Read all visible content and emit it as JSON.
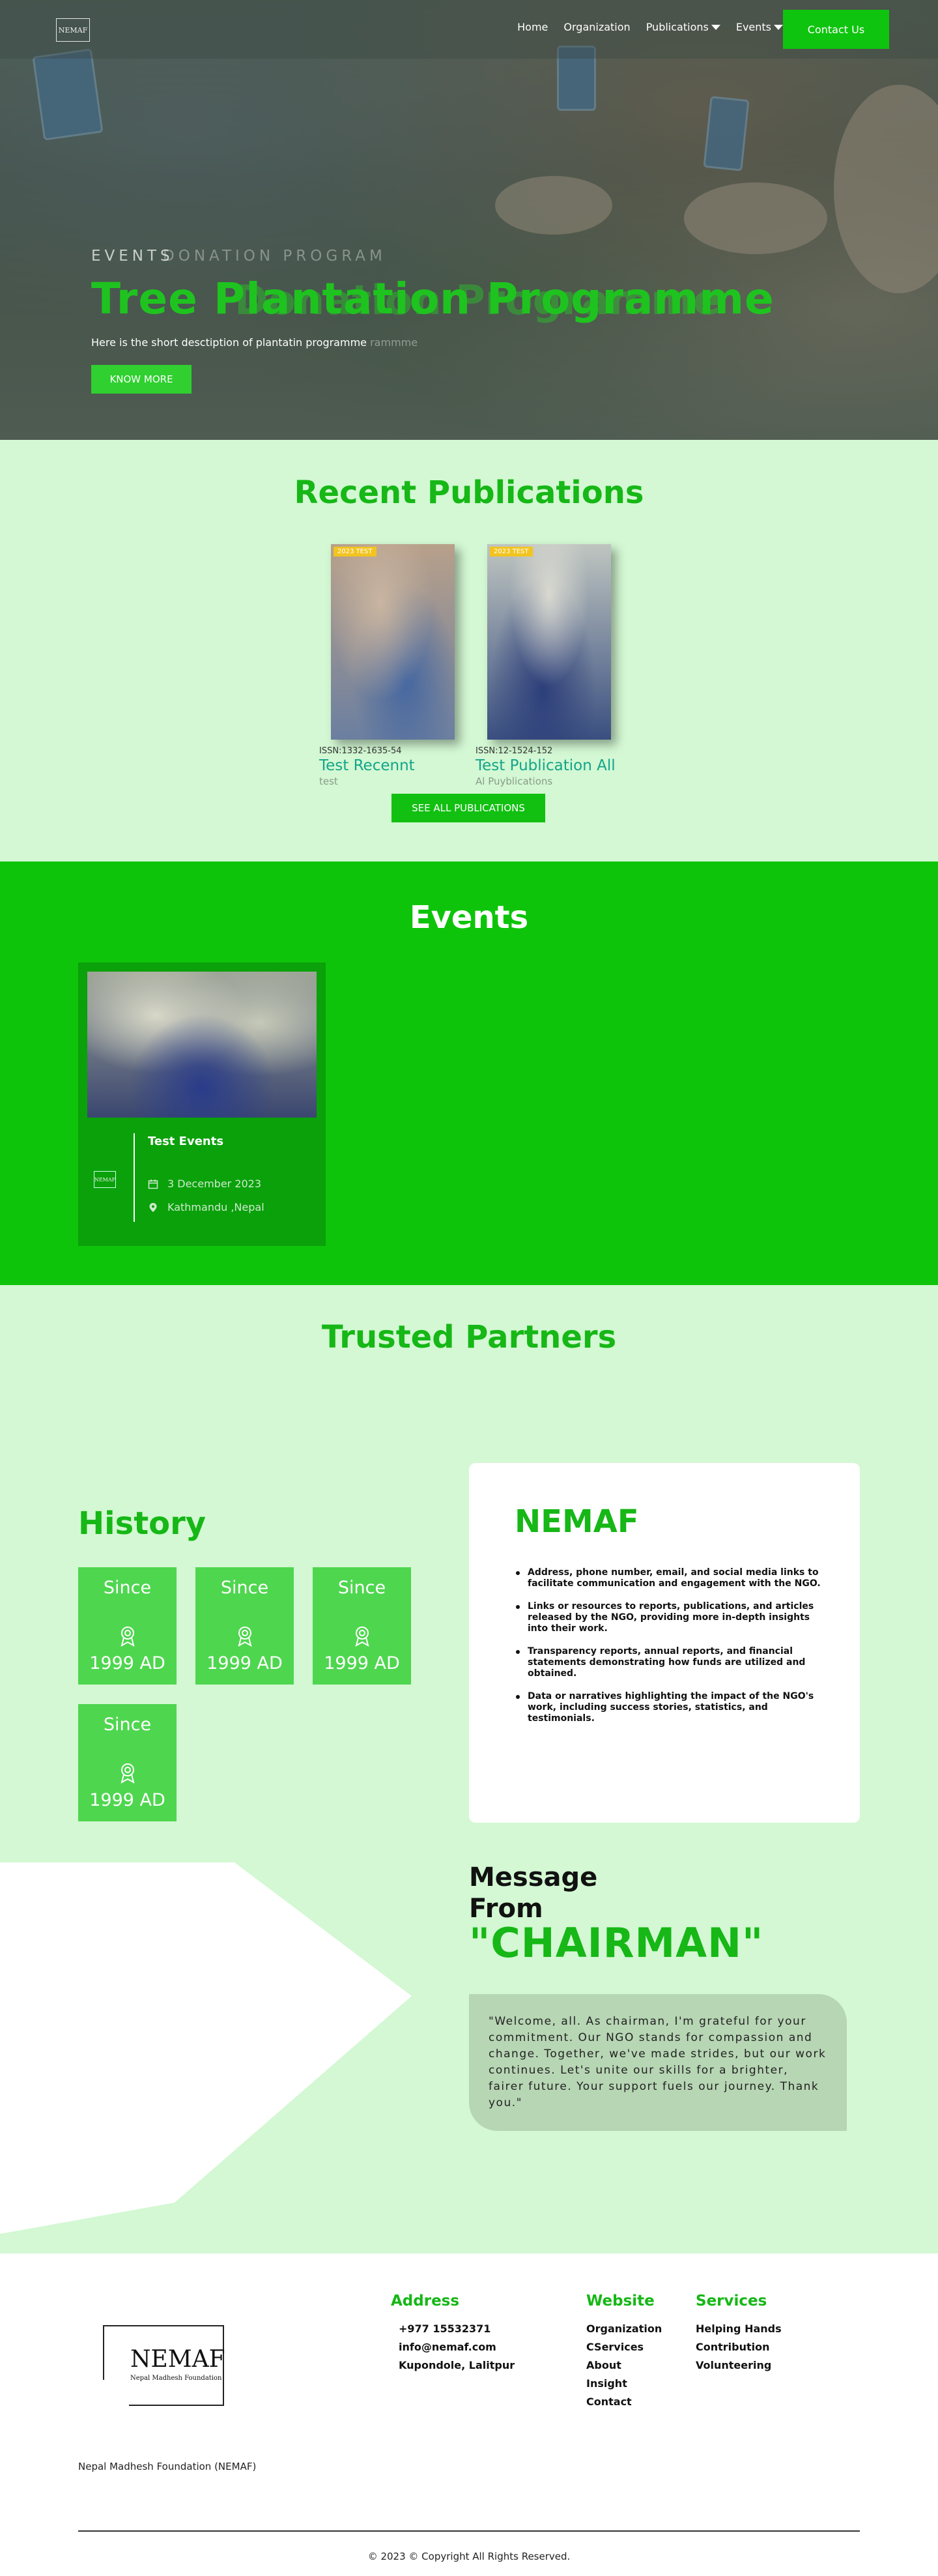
{
  "nav": {
    "logo": "NEMAF",
    "links": [
      {
        "label": "Home"
      },
      {
        "label": "Organization"
      },
      {
        "label": "Publications",
        "dropdown": true
      },
      {
        "label": "Events",
        "dropdown": true
      }
    ],
    "contact_label": "Contact Us"
  },
  "hero": {
    "eyebrow": "EVENTS",
    "eyebrow_ghost": "DONATION PROGRAM",
    "title": "Tree Plantation Programme",
    "title_ghost": "Donation Programme",
    "description": "Here is the short desctiption of plantatin programme",
    "description_ghost": "rammme",
    "button_label": "KNOW MORE"
  },
  "publications": {
    "title": "Recent Publications",
    "items": [
      {
        "tag": "2023 TEST",
        "issn": "ISSN:1332-1635-54",
        "name": "Test Recennt",
        "sub": "test"
      },
      {
        "tag": "2023 TEST",
        "issn": "ISSN:12-1524-152",
        "name": "Test Publication All",
        "sub": "Al Puyblications"
      }
    ],
    "see_all_label": "SEE ALL PUBLICATIONS"
  },
  "events": {
    "title": "Events",
    "card": {
      "logo": "NEMAF",
      "name": "Test Events",
      "date": "3 December 2023",
      "location": "Kathmandu ,Nepal"
    }
  },
  "partners": {
    "title": "Trusted Partners"
  },
  "history": {
    "title": "History",
    "boxes": [
      {
        "label": "Since",
        "year": "1999 AD"
      },
      {
        "label": "Since",
        "year": "1999 AD"
      },
      {
        "label": "Since",
        "year": "1999 AD"
      },
      {
        "label": "Since",
        "year": "1999 AD"
      }
    ]
  },
  "nemaf": {
    "title": "NEMAF",
    "points": [
      "Address, phone number, email, and social media links to facilitate communication and engagement with the NGO.",
      "Links or resources to reports, publications, and articles released by the NGO, providing more in-depth insights into their work.",
      "Transparency reports, annual reports, and financial statements demonstrating how funds are utilized and obtained.",
      "Data or narratives highlighting the impact of the NGO's work, including success stories, statistics, and testimonials."
    ]
  },
  "chairman": {
    "line1": "Message",
    "line2": "From",
    "line3": "\"CHAIRMAN\"",
    "quote": "\"Welcome, all. As chairman, I'm grateful for your commitment. Our NGO stands for compassion and change. Together, we've made strides, but our work continues. Let's unite our skills for a brighter, fairer future. Your support fuels our journey. Thank you.\""
  },
  "footer": {
    "logo_name": "NEMAF",
    "logo_sub": "Nepal Madhesh Foundation",
    "address": {
      "heading": "Address",
      "items": [
        "+977 15532371",
        "info@nemaf.com",
        "Kupondole, Lalitpur"
      ]
    },
    "website": {
      "heading": "Website",
      "items": [
        "Organization",
        "CServices",
        "About",
        "Insight",
        "Contact"
      ]
    },
    "services": {
      "heading": "Services",
      "items": [
        "Helping Hands",
        "Contribution",
        "Volunteering"
      ]
    },
    "org_name": "Nepal Madhesh Foundation (NEMAF)",
    "copyright": "© 2023 © Copyright All Rights Reserved."
  },
  "colors": {
    "brand_green": "#16b716",
    "events_bg": "#0ec40a",
    "page_bg": "#d3f8d3"
  }
}
